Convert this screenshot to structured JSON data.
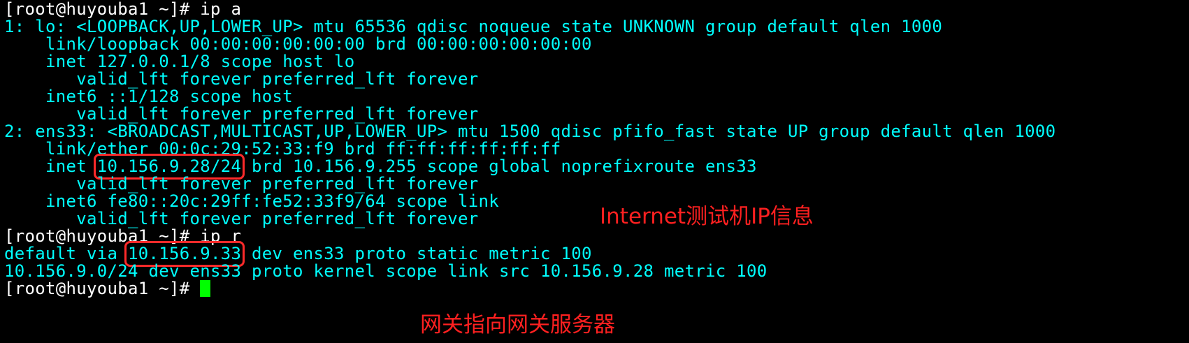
{
  "terminal": {
    "prompt": "[root@huyouba1 ~]# ",
    "commands": {
      "ip_a": "ip a",
      "ip_r": "ip r"
    },
    "lines": {
      "lo_header": "1: lo: <LOOPBACK,UP,LOWER_UP> mtu 65536 qdisc noqueue state UNKNOWN group default qlen 1000",
      "lo_link": "    link/loopback 00:00:00:00:00:00 brd 00:00:00:00:00:00",
      "lo_inet": "    inet 127.0.0.1/8 scope host lo",
      "lo_inet_valid": "       valid_lft forever preferred_lft forever",
      "lo_inet6": "    inet6 ::1/128 scope host",
      "lo_inet6_valid": "       valid_lft forever preferred_lft forever",
      "ens33_header": "2: ens33: <BROADCAST,MULTICAST,UP,LOWER_UP> mtu 1500 qdisc pfifo_fast state UP group default qlen 1000",
      "ens33_link": "    link/ether 00:0c:29:52:33:f9 brd ff:ff:ff:ff:ff:ff",
      "ens33_inet_prefix": "    inet ",
      "ens33_inet_addr": "10.156.9.28/24",
      "ens33_inet_suffix": " brd 10.156.9.255 scope global noprefixroute ens33",
      "ens33_inet_valid": "       valid_lft forever preferred_lft forever",
      "ens33_inet6": "    inet6 fe80::20c:29ff:fe52:33f9/64 scope link",
      "ens33_inet6_valid": "       valid_lft forever preferred_lft forever",
      "route_default_prefix": "default via ",
      "route_default_gw": "10.156.9.33",
      "route_default_suffix": " dev ens33 proto static metric 100",
      "route_subnet": "10.156.9.0/24 dev ens33 proto kernel scope link src 10.156.9.28 metric 100"
    }
  },
  "annotations": {
    "ip_info": "Internet测试机IP信息",
    "gateway_info": "网关指向网关服务器"
  },
  "colors": {
    "background": "#000000",
    "text": "#00ffff",
    "prompt": "#ffffff",
    "annotation": "#ff2020",
    "cursor": "#00ff00"
  }
}
